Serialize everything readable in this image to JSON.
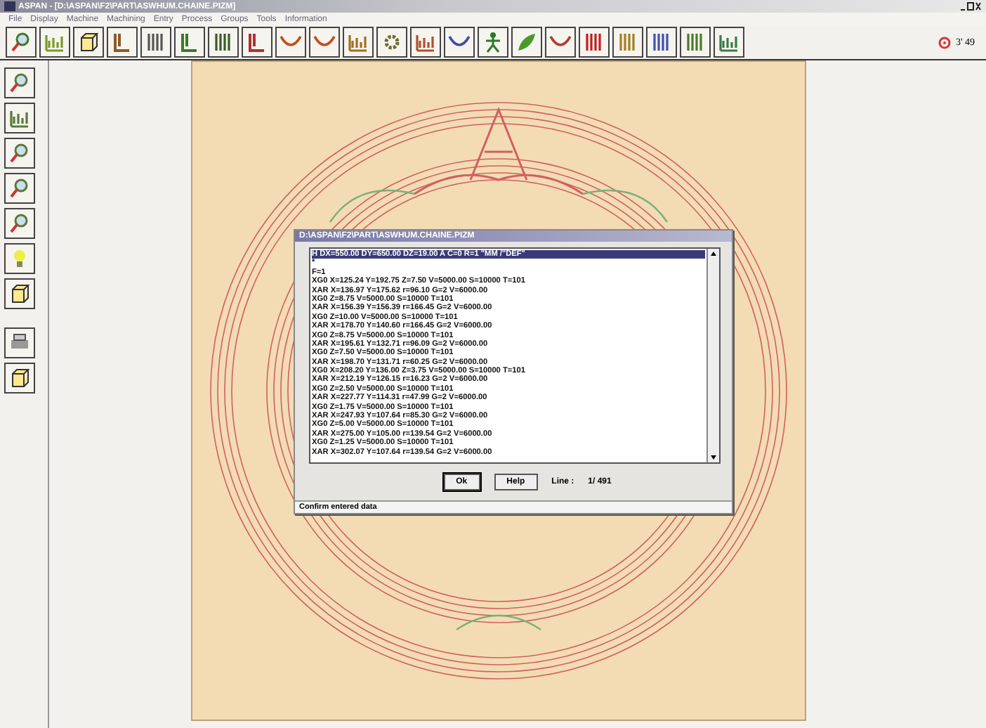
{
  "window": {
    "title": "ASPAN - [D:\\ASPAN\\F2\\PART\\ASWHUM.CHAINE.PIZM]"
  },
  "menu": [
    "File",
    "Display",
    "Machine",
    "Machining",
    "Entry",
    "Process",
    "Groups",
    "Tools",
    "Information"
  ],
  "indicator": {
    "text": "3' 49"
  },
  "dialog": {
    "title": "D:\\ASPAN\\F2\\PART\\ASWHUM.CHAINE.PIZM",
    "lines": [
      {
        "text": "H DX=550.00 DY=650.00 DZ=19.00 A C=0 R=1 \"MM /\"DEF\"",
        "selected": true
      },
      {
        "text": "*",
        "selected": false
      },
      {
        "text": "F=1",
        "selected": false
      },
      {
        "text": "XG0 X=125.24 Y=192.75 Z=7.50 V=5000.00 S=10000 T=101",
        "selected": false
      },
      {
        "text": "XAR X=136.97 Y=175.62 r=96.10 G=2 V=6000.00",
        "selected": false
      },
      {
        "text": "XG0 Z=8.75 V=5000.00 S=10000 T=101",
        "selected": false
      },
      {
        "text": "XAR X=156.39 Y=156.39 r=166.45 G=2 V=6000.00",
        "selected": false
      },
      {
        "text": "XG0 Z=10.00 V=5000.00 S=10000 T=101",
        "selected": false
      },
      {
        "text": "XAR X=178.70 Y=140.60 r=166.45 G=2 V=6000.00",
        "selected": false
      },
      {
        "text": "XG0 Z=8.75 V=5000.00 S=10000 T=101",
        "selected": false
      },
      {
        "text": "XAR X=195.61 Y=132.71 r=96.09 G=2 V=6000.00",
        "selected": false
      },
      {
        "text": "XG0 Z=7.50 V=5000.00 S=10000 T=101",
        "selected": false
      },
      {
        "text": "XAR X=198.70 Y=131.71 r=60.25 G=2 V=6000.00",
        "selected": false
      },
      {
        "text": "XG0 X=208.20 Y=136.00 Z=3.75 V=5000.00 S=10000 T=101",
        "selected": false
      },
      {
        "text": "XAR X=212.19 Y=126.15 r=16.23 G=2 V=6000.00",
        "selected": false
      },
      {
        "text": "XG0 Z=2.50 V=5000.00 S=10000 T=101",
        "selected": false
      },
      {
        "text": "XAR X=227.77 Y=114.31 r=47.99 G=2 V=6000.00",
        "selected": false
      },
      {
        "text": "XG0 Z=1.75 V=5000.00 S=10000 T=101",
        "selected": false
      },
      {
        "text": "XAR X=247.93 Y=107.64 r=85.30 G=2 V=6000.00",
        "selected": false
      },
      {
        "text": "XG0 Z=5.00 V=5000.00 S=10000 T=101",
        "selected": false
      },
      {
        "text": "XAR X=275.00 Y=105.00 r=139.54 G=2 V=6000.00",
        "selected": false
      },
      {
        "text": "XG0 Z=1.25 V=5000.00 S=10000 T=101",
        "selected": false
      },
      {
        "text": "XAR X=302.07 Y=107.64 r=139.54 G=2 V=6000.00",
        "selected": false
      }
    ],
    "buttons": [
      "Ok",
      "Help"
    ],
    "line_label": "Line :",
    "line_value": "1/ 491",
    "status": "Confirm entered data"
  }
}
